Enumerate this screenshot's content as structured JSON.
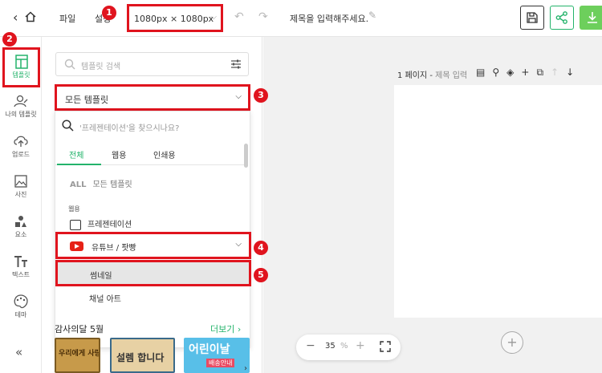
{
  "topbar": {
    "file_menu": "파일",
    "settings_menu": "설정",
    "canvas_size": "1080px × 1080px",
    "doc_title": "제목을 입력해주세요."
  },
  "markers": [
    "1",
    "2",
    "3",
    "4",
    "5"
  ],
  "rail": {
    "items": [
      {
        "label": "템플릿",
        "icon": "template-icon"
      },
      {
        "label": "나의 템플릿",
        "icon": "my-template-icon"
      },
      {
        "label": "업로드",
        "icon": "upload-icon"
      },
      {
        "label": "사진",
        "icon": "photo-icon"
      },
      {
        "label": "요소",
        "icon": "elements-icon"
      },
      {
        "label": "텍스트",
        "icon": "text-icon"
      },
      {
        "label": "테마",
        "icon": "theme-icon"
      }
    ],
    "collapse": "«"
  },
  "panel": {
    "search_placeholder": "템플릿 검색",
    "dropdown_selected": "모든 템플릿",
    "dd_search_placeholder": "'프레젠테이션'을 찾으시나요?",
    "tabs": [
      "전체",
      "웹용",
      "인쇄용"
    ],
    "all_badge": "ALL",
    "all_label": "모든 템플릿",
    "web_section": "웹용",
    "presentation": "프레젠테이션",
    "youtube": "유튜브 / 팟빵",
    "thumbnail": "썸네일",
    "channel_art": "채널 아트",
    "section_title": "감사의달 5월",
    "more": "더보기",
    "thumb1_text": "우리에게 사랑하는",
    "thumb2_text": "설렘 합니다",
    "thumb3_text": "어린이날",
    "thumb3_sub": "배송안내"
  },
  "canvas": {
    "page_label": "1 페이지 -",
    "page_sub": "제목 입력",
    "zoom_value": "35",
    "zoom_unit": "%"
  },
  "colors": {
    "accent": "#24b36b",
    "highlight": "#e0141e"
  }
}
